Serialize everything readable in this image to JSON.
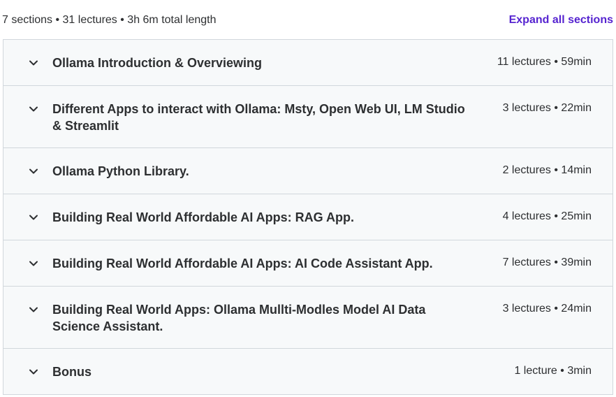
{
  "header": {
    "summary": "7 sections • 31 lectures • 3h 6m total length",
    "expand_label": "Expand all sections"
  },
  "sections": [
    {
      "title": "Ollama Introduction & Overviewing",
      "meta": "11 lectures • 59min"
    },
    {
      "title": "Different Apps to interact with Ollama: Msty, Open Web UI, LM Studio & Streamlit",
      "meta": "3 lectures • 22min"
    },
    {
      "title": "Ollama Python Library.",
      "meta": "2 lectures • 14min"
    },
    {
      "title": "Building Real World Affordable AI Apps: RAG App.",
      "meta": "4 lectures • 25min"
    },
    {
      "title": "Building Real World Affordable AI Apps: AI Code Assistant App.",
      "meta": "7 lectures • 39min"
    },
    {
      "title": "Building Real World Apps: Ollama Mullti-Modles Model AI Data Science Assistant.",
      "meta": "3 lectures • 24min"
    },
    {
      "title": "Bonus",
      "meta": "1 lecture • 3min"
    }
  ],
  "icons": {
    "section_toggle": "chevron-down-icon"
  }
}
